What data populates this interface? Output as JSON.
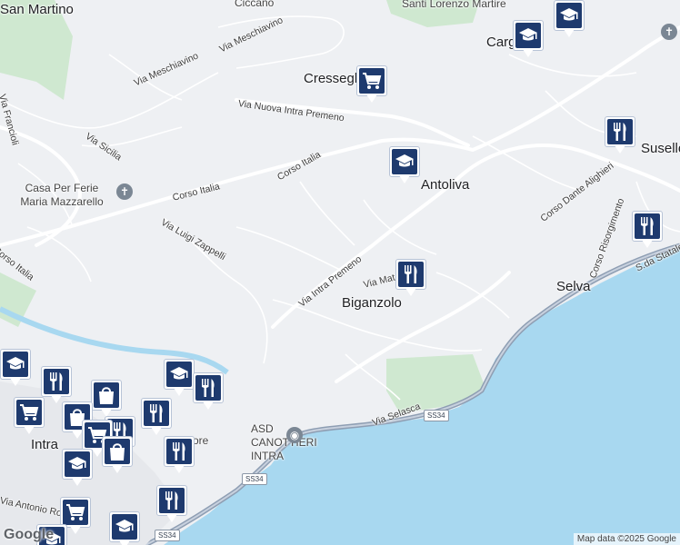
{
  "map": {
    "colors": {
      "land": "#eef0f3",
      "water": "#a8d8f0",
      "park": "#cfe8d0",
      "road": "#ffffff",
      "highway": "#8e9eb3",
      "marker": "#1e3a6e"
    },
    "labels": {
      "san_martino": "San Martino",
      "cresseglio": "Cresseglio",
      "cargiago": "Cargiago",
      "santi_lorenzo": "Santi Lorenzo Martire",
      "antoliva": "Antoliva",
      "susello": "Susello",
      "biganzolo": "Biganzolo",
      "selva": "Selva",
      "intra": "Intra",
      "casa_ferie": "Casa Per Ferie Maria Mazzarello",
      "asd": "ASD CANOTTIERI INTRA",
      "ciccano": "Ciccano",
      "villa_fiore": "ore"
    },
    "streets": {
      "via_meschiavino_1": "Via Meschiavino",
      "via_meschiavino_2": "Via Meschiavino",
      "via_nuova_intra_premeno": "Via Nuova Intra Premeno",
      "via_francioli": "Via Francioli",
      "via_sicilia": "Via Sicilia",
      "corso_italia_1": "Corso Italia",
      "corso_italia_2": "Corso Italia",
      "corso_italia_3": "Corso Italia",
      "via_luigi_zappelli": "Via Luigi Zappelli",
      "via_intra_premeno": "Via Intra Premeno",
      "via_mat": "Via Mat",
      "corso_dante": "Corso Dante Alighieri",
      "corso_risorgimento": "Corso Risorgimento",
      "sda_statale": "S.da Statale",
      "via_selasca": "Via Selasca",
      "via_antonio_rosmini": "Via Antonio Rosmini"
    },
    "road_badges": {
      "ss34_1": "SS34",
      "ss34_2": "SS34",
      "ss34_3": "SS34"
    },
    "markers": [
      {
        "name": "school-marker",
        "icon": "graduation-cap-icon"
      },
      {
        "name": "school-marker",
        "icon": "graduation-cap-icon"
      },
      {
        "name": "shop-marker",
        "icon": "shopping-cart-icon"
      },
      {
        "name": "school-marker",
        "icon": "graduation-cap-icon"
      },
      {
        "name": "restaurant-marker",
        "icon": "cutlery-icon"
      },
      {
        "name": "restaurant-marker",
        "icon": "cutlery-icon"
      },
      {
        "name": "restaurant-marker",
        "icon": "cutlery-icon"
      },
      {
        "name": "school-marker",
        "icon": "graduation-cap-icon"
      },
      {
        "name": "restaurant-marker",
        "icon": "cutlery-icon"
      },
      {
        "name": "shop-marker",
        "icon": "shopping-bag-icon"
      },
      {
        "name": "shop-marker",
        "icon": "shopping-cart-icon"
      },
      {
        "name": "school-marker",
        "icon": "graduation-cap-icon"
      },
      {
        "name": "restaurant-marker",
        "icon": "cutlery-icon"
      },
      {
        "name": "shop-marker",
        "icon": "shopping-bag-icon"
      },
      {
        "name": "restaurant-marker",
        "icon": "cutlery-icon"
      },
      {
        "name": "restaurant-marker",
        "icon": "cutlery-icon"
      },
      {
        "name": "shop-marker",
        "icon": "shopping-cart-icon"
      },
      {
        "name": "school-marker",
        "icon": "graduation-cap-icon"
      },
      {
        "name": "restaurant-marker",
        "icon": "cutlery-icon"
      },
      {
        "name": "shop-marker",
        "icon": "shopping-bag-icon"
      },
      {
        "name": "restaurant-marker",
        "icon": "cutlery-icon"
      },
      {
        "name": "shop-marker",
        "icon": "shopping-cart-icon"
      },
      {
        "name": "school-marker",
        "icon": "graduation-cap-icon"
      },
      {
        "name": "school-marker",
        "icon": "graduation-cap-icon"
      }
    ],
    "attribution": "Map data ©2025 Google",
    "logo": "Google"
  }
}
